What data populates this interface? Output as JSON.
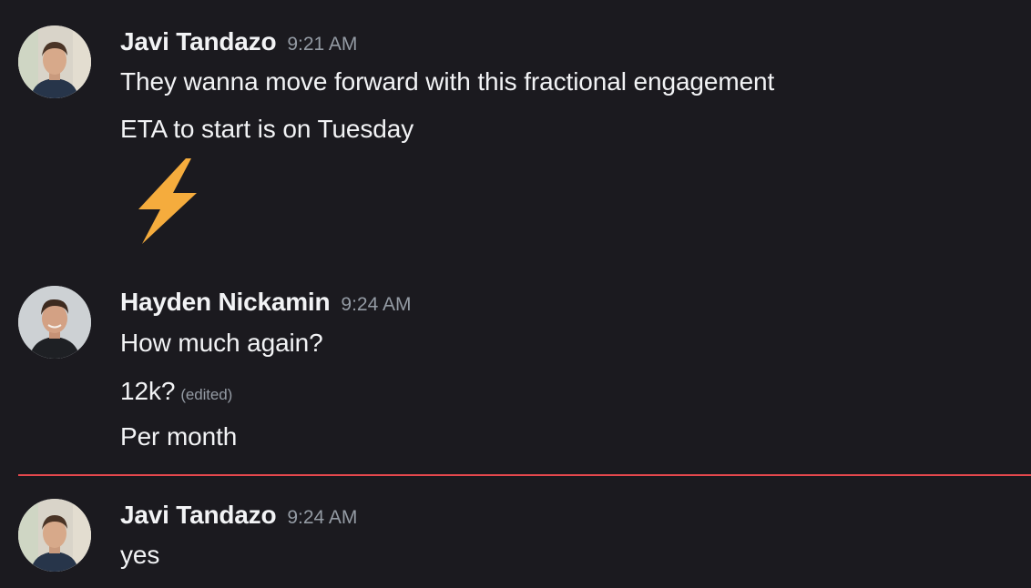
{
  "messages": [
    {
      "author": "Javi Tandazo",
      "time": "9:21 AM",
      "lines": [
        "They wanna move forward with this fractional engagement",
        "ETA to start is on Tuesday"
      ],
      "emoji": "high-voltage"
    },
    {
      "author": "Hayden Nickamin",
      "time": "9:24 AM",
      "lines": [
        "How much again?",
        "12k?",
        "Per month"
      ],
      "edited_label": "(edited)"
    },
    {
      "author": "Javi Tandazo",
      "time": "9:24 AM",
      "lines": [
        "yes"
      ]
    }
  ],
  "colors": {
    "background": "#1b1a1f",
    "text": "#f2f3f5",
    "muted": "#949ba4",
    "new_messages_divider": "#e5484d",
    "emoji": "#f5ac3d"
  }
}
